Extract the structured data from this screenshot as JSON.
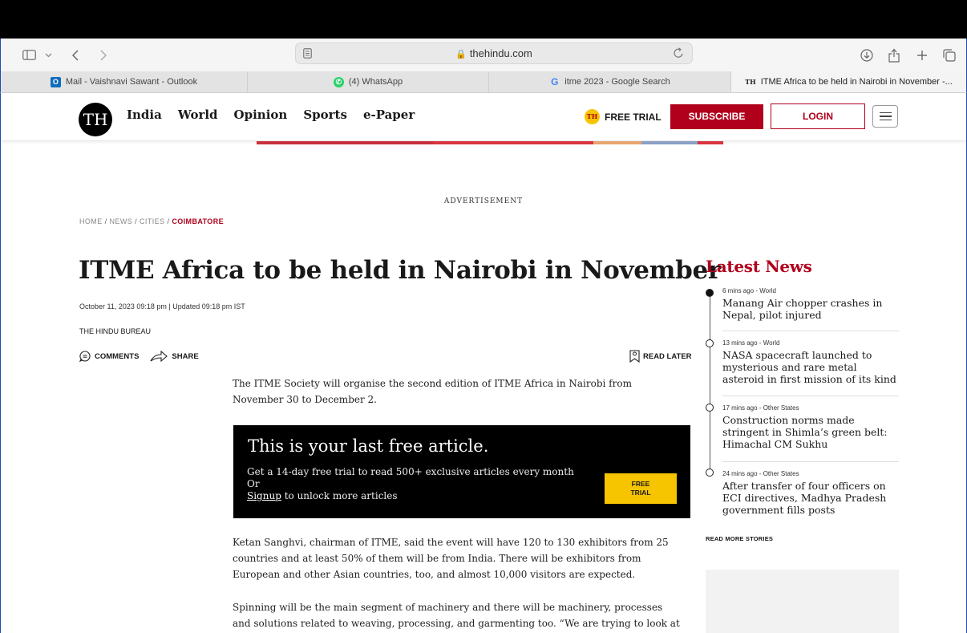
{
  "browser": {
    "url": "thehindu.com",
    "tabs": [
      {
        "label": "Mail - Vaishnavi Sawant - Outlook",
        "favicon": "outlook-icon",
        "favicon_color": "#0f6cbd"
      },
      {
        "label": "(4) WhatsApp",
        "favicon": "whatsapp-icon",
        "favicon_color": "#25d366"
      },
      {
        "label": "itme 2023 - Google Search",
        "favicon": "google-icon",
        "favicon_color": "#4285f4"
      },
      {
        "label": "ITME Africa to be held in Nairobi in November -...",
        "favicon": "the-hindu-icon",
        "favicon_color": "#000000"
      }
    ],
    "favicon_text": {
      "outlook": "O",
      "google": "G",
      "hindu": "TH"
    }
  },
  "site": {
    "logo": "TH",
    "nav": [
      "India",
      "World",
      "Opinion",
      "Sports",
      "e-Paper"
    ],
    "free_trial_badge": "TH",
    "free_trial": "FREE TRIAL",
    "subscribe": "SUBSCRIBE",
    "login": "LOGIN",
    "accent_color": "#b1001c",
    "highlight_color": "#f7c400"
  },
  "article": {
    "ad_label": "ADVERTISEMENT",
    "breadcrumb": [
      "HOME",
      "NEWS",
      "CITIES",
      "COIMBATORE"
    ],
    "breadcrumb_sep": "/",
    "headline": "ITME Africa to be held in Nairobi in November",
    "dateline": "October 11, 2023 09:18 pm | Updated 09:18 pm IST",
    "author": "THE HINDU BUREAU",
    "comments": "COMMENTS",
    "share": "SHARE",
    "read_later": "READ LATER",
    "intro_line1": "The ITME Society will organise the second edition of ITME Africa in Nairobi from",
    "intro_line2": "November 30 to December 2.",
    "paywall": {
      "title": "This is your last free article.",
      "line1": "Get a 14-day free trial to read 500+ exclusive articles every month",
      "line2": "Or",
      "signup": "Signup",
      "line3_rest": " to unlock more articles",
      "button_line1": "FREE",
      "button_line2": "TRIAL"
    },
    "para2_line1": "Ketan Sanghvi, chairman of ITME, said the event will have 120 to 130 exhibitors from 25",
    "para2_line2": "countries and at least 50% of them will be from India. There will be exhibitors from",
    "para2_line3": "European and other Asian countries, too, and almost 10,000 visitors are expected.",
    "para3_line1": "Spinning will be the main segment of machinery and there will be machinery, processes",
    "para3_line2": "and solutions related to weaving, processing, and garmenting too. “We are trying to look at"
  },
  "sidebar": {
    "title": "Latest News",
    "items": [
      {
        "meta": "6 mins ago - World",
        "line1": "Manang Air chopper crashes in",
        "line2": "Nepal, pilot injured",
        "line3": ""
      },
      {
        "meta": "13 mins ago - World",
        "line1": "NASA spacecraft launched to",
        "line2": "mysterious and rare metal",
        "line3": "asteroid in first mission of its kind"
      },
      {
        "meta": "17 mins ago - Other States",
        "line1": "Construction norms made",
        "line2": "stringent in Shimla’s green belt:",
        "line3": "Himachal CM Sukhu"
      },
      {
        "meta": "24 mins ago - Other States",
        "line1": "After transfer of four officers on",
        "line2": "ECI directives, Madhya Pradesh",
        "line3": "government fills posts"
      }
    ],
    "read_more": "READ MORE STORIES"
  }
}
